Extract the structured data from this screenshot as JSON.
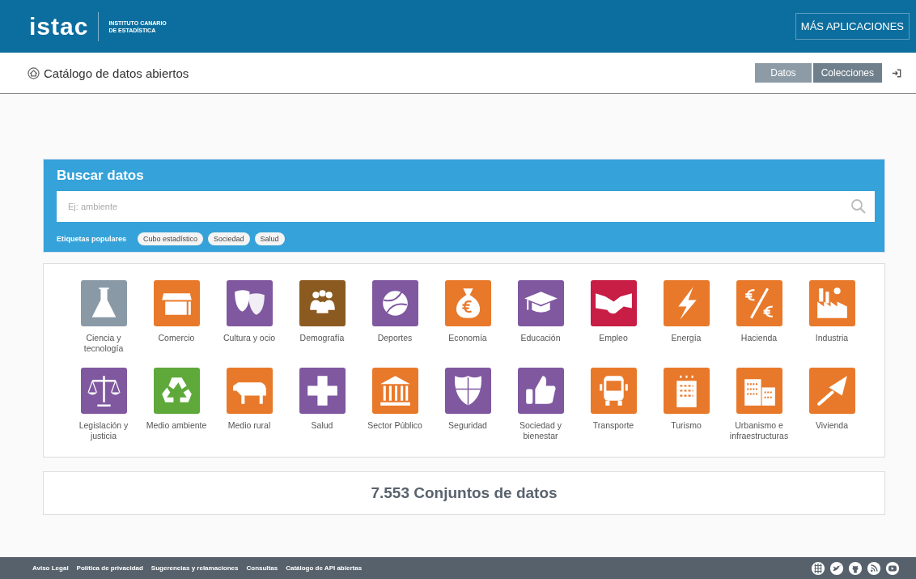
{
  "header": {
    "logo": "istac",
    "institute": [
      "INSTITUTO CANARIO",
      "DE ESTADÍSTICA"
    ],
    "apps_button": "MÁS APLICACIONES"
  },
  "subheader": {
    "title": "Catálogo de datos abiertos",
    "tabs": [
      {
        "label": "Datos",
        "selected": true
      },
      {
        "label": "Colecciones",
        "selected": false
      }
    ]
  },
  "search": {
    "title": "Buscar datos",
    "placeholder": "Ej: ambiente",
    "tags_label": "Etiquetas populares",
    "tags": [
      "Cubo estadístico",
      "Sociedad",
      "Salud"
    ]
  },
  "categories": [
    {
      "label": "Ciencia y tecnología",
      "color": "#8a99a6"
    },
    {
      "label": "Comercio",
      "color": "#e8792b"
    },
    {
      "label": "Cultura y ocio",
      "color": "#7f58a0"
    },
    {
      "label": "Demografía",
      "color": "#8b5a20"
    },
    {
      "label": "Deportes",
      "color": "#7f58a0"
    },
    {
      "label": "Economía",
      "color": "#e8792b"
    },
    {
      "label": "Educación",
      "color": "#7f58a0"
    },
    {
      "label": "Empleo",
      "color": "#c81d45"
    },
    {
      "label": "Energía",
      "color": "#e8792b"
    },
    {
      "label": "Hacienda",
      "color": "#e8792b"
    },
    {
      "label": "Industria",
      "color": "#e8792b"
    },
    {
      "label": "Legislación y justicia",
      "color": "#7f58a0"
    },
    {
      "label": "Medio ambiente",
      "color": "#5fa83a"
    },
    {
      "label": "Medio rural",
      "color": "#e8792b"
    },
    {
      "label": "Salud",
      "color": "#7f58a0"
    },
    {
      "label": "Sector Público",
      "color": "#e8792b"
    },
    {
      "label": "Seguridad",
      "color": "#7f58a0"
    },
    {
      "label": "Sociedad y bienestar",
      "color": "#7f58a0"
    },
    {
      "label": "Transporte",
      "color": "#e8792b"
    },
    {
      "label": "Turismo",
      "color": "#e8792b"
    },
    {
      "label": "Urbanismo e infraestructuras",
      "color": "#e8792b"
    },
    {
      "label": "Vivienda",
      "color": "#e8792b"
    }
  ],
  "summary": "7.553 Conjuntos de datos",
  "footer": {
    "links": [
      "Aviso Legal",
      "Política de privacidad",
      "Sugerencias y relamaciones",
      "Consultas",
      "Catálogo de API abiertas"
    ]
  }
}
